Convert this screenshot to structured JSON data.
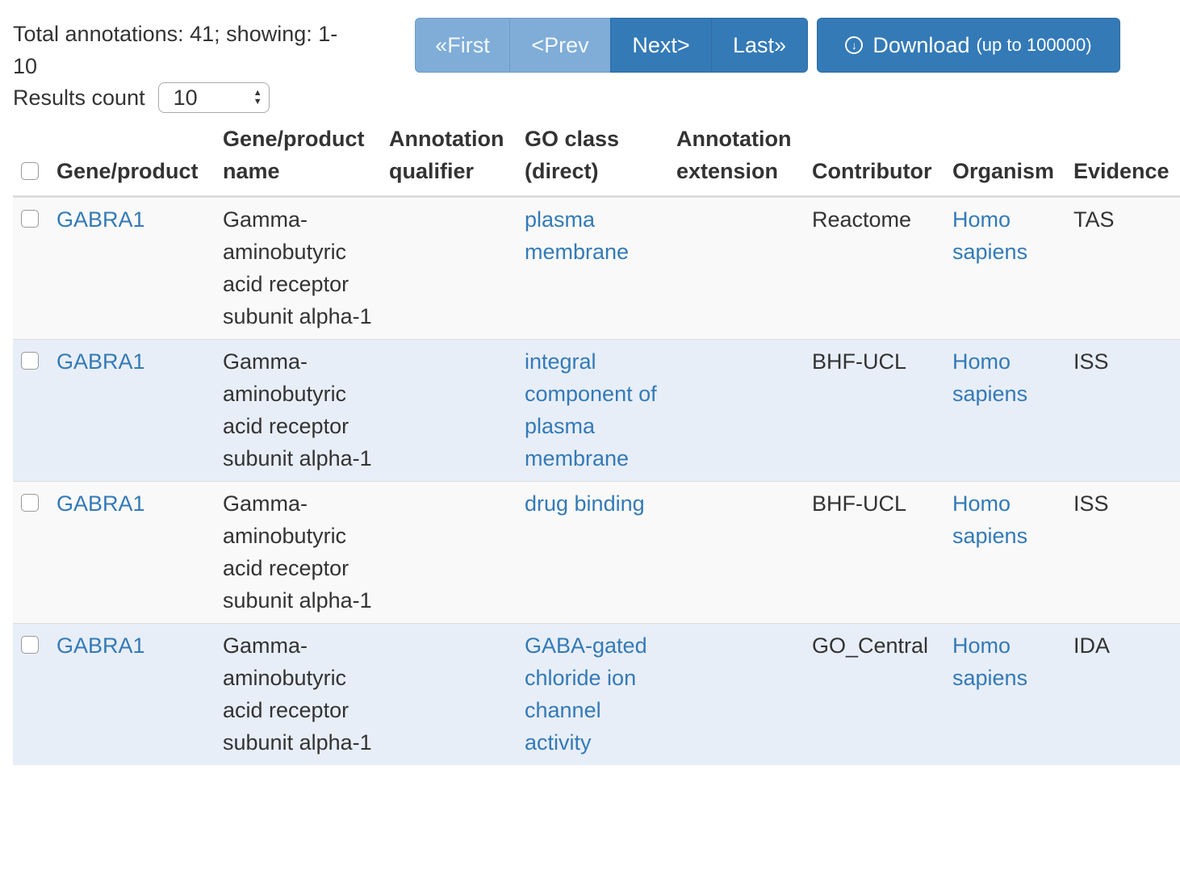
{
  "summary": {
    "line1": "Total annotations: 41; showing: 1-",
    "line2": "10"
  },
  "results_count": {
    "label": "Results count",
    "value": "10"
  },
  "pager": {
    "first": "«First",
    "prev": "<Prev",
    "next": "Next>",
    "last": "Last»"
  },
  "download": {
    "label": "Download",
    "note": "(up to 100000)"
  },
  "colors": {
    "primary": "#337ab7",
    "primary_disabled": "#7fadd8",
    "link": "#337ab7",
    "row_alt": "#e8eef8"
  },
  "table": {
    "headers": {
      "gene_product": "Gene/product",
      "gene_product_name_1": "Gene/product",
      "gene_product_name_2": "name",
      "qualifier_1": "Annotation",
      "qualifier_2": "qualifier",
      "go_class_1": "GO class",
      "go_class_2": "(direct)",
      "extension_1": "Annotation",
      "extension_2": "extension",
      "contributor": "Contributor",
      "organism": "Organism",
      "evidence": "Evidence"
    },
    "rows": [
      {
        "gene": "GABRA1",
        "name": "Gamma-aminobutyric acid receptor subunit alpha-1",
        "qualifier": "",
        "go_class": "plasma membrane",
        "extension": "",
        "contributor": "Reactome",
        "organism": "Homo sapiens",
        "evidence": "TAS"
      },
      {
        "gene": "GABRA1",
        "name": "Gamma-aminobutyric acid receptor subunit alpha-1",
        "qualifier": "",
        "go_class": "integral component of plasma membrane",
        "extension": "",
        "contributor": "BHF-UCL",
        "organism": "Homo sapiens",
        "evidence": "ISS"
      },
      {
        "gene": "GABRA1",
        "name": "Gamma-aminobutyric acid receptor subunit alpha-1",
        "qualifier": "",
        "go_class": "drug binding",
        "extension": "",
        "contributor": "BHF-UCL",
        "organism": "Homo sapiens",
        "evidence": "ISS"
      },
      {
        "gene": "GABRA1",
        "name": "Gamma-aminobutyric acid receptor subunit alpha-1",
        "qualifier": "",
        "go_class": "GABA-gated chloride ion channel activity",
        "extension": "",
        "contributor": "GO_Central",
        "organism": "Homo sapiens",
        "evidence": "IDA"
      }
    ]
  }
}
